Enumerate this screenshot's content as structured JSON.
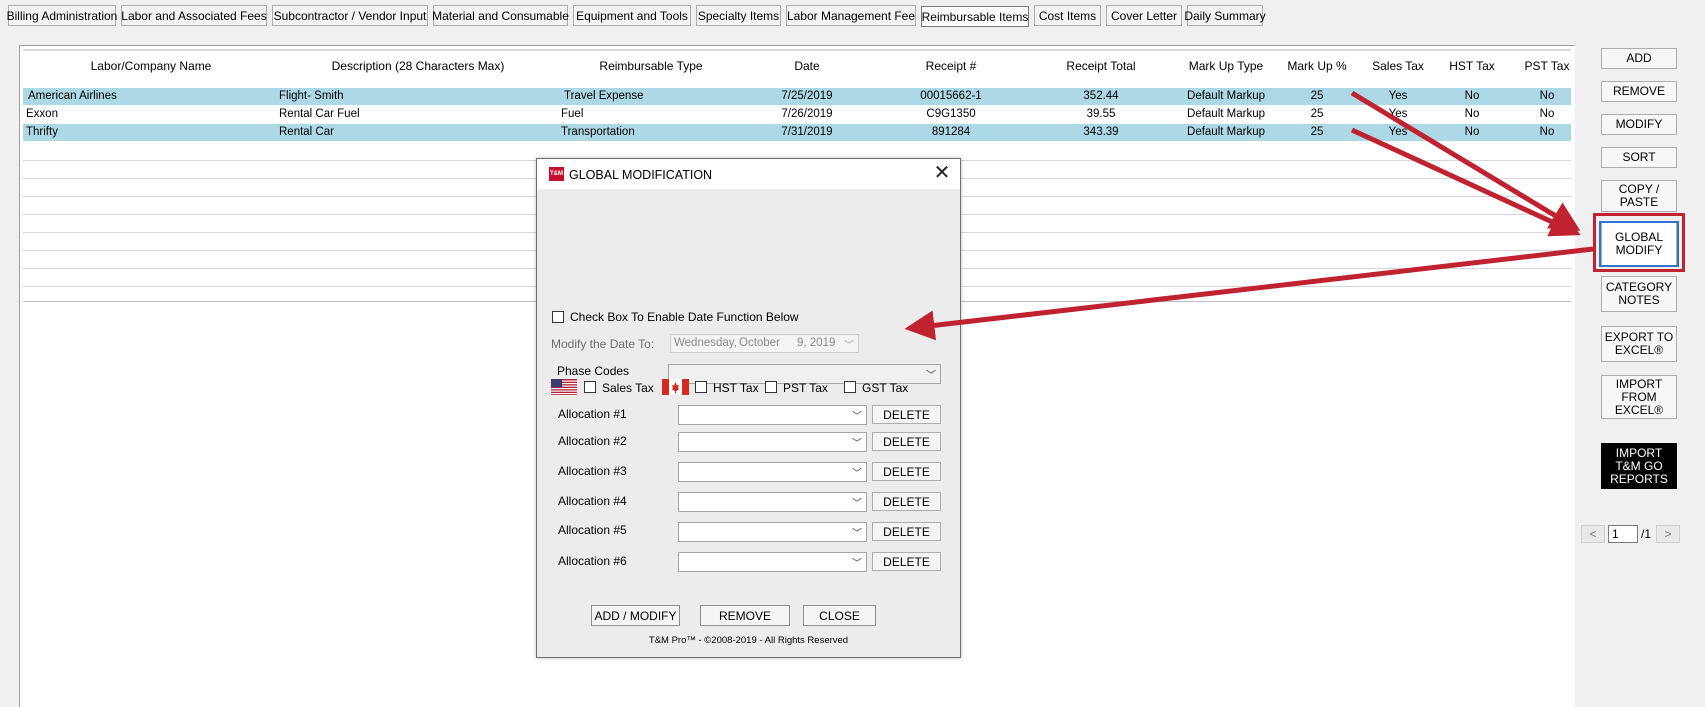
{
  "tabs": [
    {
      "label": "Billing Administration"
    },
    {
      "label": "Labor and Associated Fees"
    },
    {
      "label": "Subcontractor / Vendor Input"
    },
    {
      "label": "Material and Consumable"
    },
    {
      "label": "Equipment and Tools"
    },
    {
      "label": "Specialty Items"
    },
    {
      "label": "Labor Management Fee"
    },
    {
      "label": "Reimbursable Items",
      "active": true
    },
    {
      "label": "Cost Items"
    },
    {
      "label": "Cover Letter"
    },
    {
      "label": "Daily Summary"
    }
  ],
  "grid": {
    "columns": [
      "Labor/Company Name",
      "Description (28 Characters Max)",
      "Reimbursable Type",
      "Date",
      "Receipt #",
      "Receipt Total",
      "Mark Up Type",
      "Mark Up %",
      "Sales Tax",
      "HST Tax",
      "PST Tax"
    ],
    "rows": [
      {
        "name": "American Airlines",
        "description": "Flight- Smith",
        "type": "Travel Expense",
        "date": "7/25/2019",
        "receipt": "00015662-1",
        "total": "352.44",
        "markup_type": "Default Markup",
        "markup_pct": "25",
        "sales_tax": "Yes",
        "hst": "No",
        "pst": "No",
        "selected": true
      },
      {
        "name": "Exxon",
        "description": "Rental Car Fuel",
        "type": "Fuel",
        "date": "7/26/2019",
        "receipt": "C9G1350",
        "total": "39.55",
        "markup_type": "Default Markup",
        "markup_pct": "25",
        "sales_tax": "Yes",
        "hst": "No",
        "pst": "No",
        "selected": false
      },
      {
        "name": "Thrifty",
        "description": "Rental Car",
        "type": "Transportation",
        "date": "7/31/2019",
        "receipt": "891284",
        "total": "343.39",
        "markup_type": "Default Markup",
        "markup_pct": "25",
        "sales_tax": "Yes",
        "hst": "No",
        "pst": "No",
        "selected": true
      }
    ]
  },
  "side_buttons": {
    "add": "ADD",
    "remove": "REMOVE",
    "modify": "MODIFY",
    "sort": "SORT",
    "copy_paste": [
      "COPY /",
      "PASTE"
    ],
    "global_modify": [
      "GLOBAL",
      "MODIFY"
    ],
    "category_notes": [
      "CATEGORY",
      "NOTES"
    ],
    "export_excel": [
      "EXPORT TO",
      "EXCEL®"
    ],
    "import_excel": [
      "IMPORT",
      "FROM",
      "EXCEL®"
    ],
    "import_reports": [
      "IMPORT",
      "T&M GO",
      "REPORTS"
    ]
  },
  "pager": {
    "prev": "<",
    "next": ">",
    "page": "1",
    "total": "/1"
  },
  "dialog": {
    "icon_text": "T&M",
    "title": "GLOBAL MODIFICATION",
    "close": "✕",
    "enable_date_label": "Check Box To Enable Date Function Below",
    "modify_date_label": "Modify the Date To:",
    "date_day": "Wednesday,",
    "date_month": "October",
    "date_daynum": "9, 2019",
    "phase_codes_label": "Phase Codes",
    "sales_tax": "Sales Tax",
    "hst_tax": "HST Tax",
    "pst_tax": "PST Tax",
    "gst_tax": "GST Tax",
    "allocations": [
      "Allocation #1",
      "Allocation #2",
      "Allocation #3",
      "Allocation #4",
      "Allocation #5",
      "Allocation #6"
    ],
    "delete_label": "DELETE",
    "add_modify": "ADD / MODIFY",
    "remove": "REMOVE",
    "close_btn": "CLOSE",
    "copyright": "T&M Pro™ - ©2008-2019 - All Rights Reserved"
  },
  "colors": {
    "selected_row": "#add8e6",
    "annotation_red": "#c0222f",
    "focus_blue": "#2f74d0"
  }
}
